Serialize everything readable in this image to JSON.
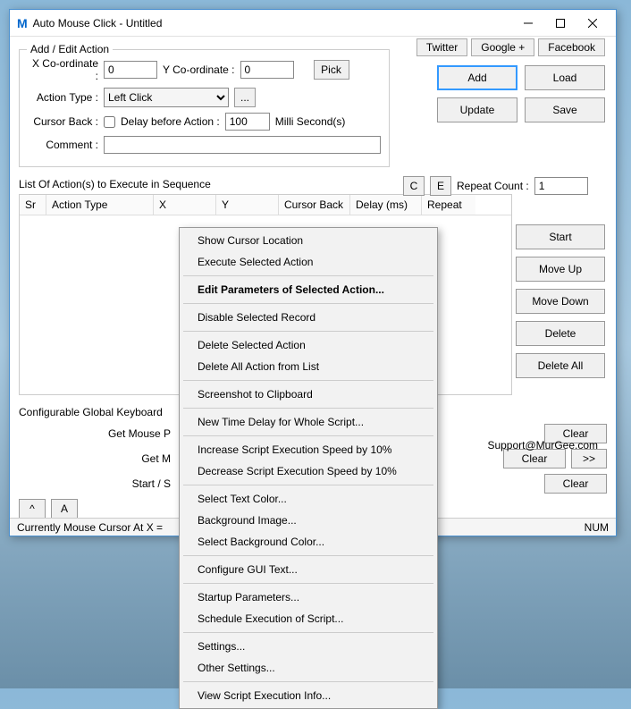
{
  "window": {
    "title": "Auto Mouse Click - Untitled"
  },
  "toplinks": {
    "twitter": "Twitter",
    "google": "Google +",
    "facebook": "Facebook"
  },
  "addedit": {
    "legend": "Add / Edit Action",
    "xlabel": "X Co-ordinate :",
    "xval": "0",
    "ylabel": "Y Co-ordinate :",
    "yval": "0",
    "pick": "Pick",
    "actiontypelabel": "Action Type :",
    "actiontype": "Left Click",
    "dots": "...",
    "cursorbacklabel": "Cursor Back :",
    "delaylabel": "Delay before Action :",
    "delayval": "100",
    "delayunit": "Milli Second(s)",
    "commentlabel": "Comment :",
    "commentval": "",
    "cbtn": "C",
    "ebtn": "E",
    "repeatlabel": "Repeat Count :",
    "repeatval": "1"
  },
  "mainbtns": {
    "add": "Add",
    "load": "Load",
    "update": "Update",
    "save": "Save"
  },
  "listlabel": "List Of Action(s) to Execute in Sequence",
  "cols": {
    "sr": "Sr",
    "action": "Action Type",
    "x": "X",
    "y": "Y",
    "cb": "Cursor Back",
    "delay": "Delay (ms)",
    "repeat": "Repeat"
  },
  "sidebtns": {
    "start": "Start",
    "moveup": "Move Up",
    "movedown": "Move Down",
    "delete": "Delete",
    "deleteall": "Delete All"
  },
  "support": "Support@MurGee.com",
  "config": {
    "label": "Configurable Global Keyboard",
    "row1lbl": "Get Mouse P",
    "row2lbl": "Get M",
    "row3lbl": "Start / S",
    "clear": "Clear",
    "more": ">>",
    "caret": "^",
    "a": "A"
  },
  "status": {
    "text": "Currently Mouse Cursor At X = ",
    "num": "NUM"
  },
  "menu": {
    "i1": "Show Cursor Location",
    "i2": "Execute Selected Action",
    "i3": "Edit Parameters of Selected Action...",
    "i4": "Disable Selected Record",
    "i5": "Delete Selected Action",
    "i6": "Delete All Action from List",
    "i7": "Screenshot to Clipboard",
    "i8": "New Time Delay for Whole Script...",
    "i9": "Increase Script Execution Speed by 10%",
    "i10": "Decrease Script Execution Speed by 10%",
    "i11": "Select Text Color...",
    "i12": "Background Image...",
    "i13": "Select Background Color...",
    "i14": "Configure GUI Text...",
    "i15": "Startup Parameters...",
    "i16": "Schedule Execution of Script...",
    "i17": "Settings...",
    "i18": "Other Settings...",
    "i19": "View Script Execution Info..."
  }
}
